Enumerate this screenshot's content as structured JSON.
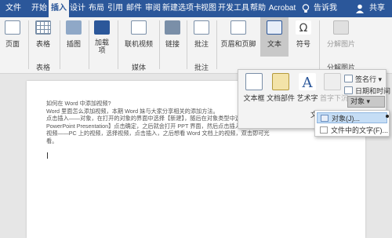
{
  "tabs": {
    "file": "文件",
    "home": "开始",
    "insert": "插入",
    "design": "设计",
    "layout": "布局",
    "references": "引用",
    "mailings": "邮件",
    "review": "审阅",
    "newtab": "新建选项卡",
    "view": "视图",
    "developer": "开发工具",
    "help": "帮助",
    "acrobat": "Acrobat",
    "tell_me": "告诉我",
    "share": "共享"
  },
  "ribbon": {
    "page": "页面",
    "table": "表格",
    "illustrations": "插图",
    "addins": "加载\n项",
    "online_video": "联机视频",
    "links": "链接",
    "comment": "批注",
    "header_footer": "页眉和页脚",
    "text": "文本",
    "symbols": "符号",
    "split_images": "分解图片",
    "groups": {
      "table": "表格",
      "media": "媒体",
      "comments": "批注",
      "split_images": "分解图片"
    }
  },
  "text_panel": {
    "textbox": "文本框",
    "quickparts": "文档部件",
    "wordart": "艺术字",
    "dropcap": "首字下沉",
    "signature_line": "签名行",
    "date_time": "日期和时间",
    "object": "对象",
    "group_label": "文"
  },
  "object_menu": {
    "object_item": "对象(J)...",
    "text_from_file": "文件中的文字(F)..."
  },
  "document": {
    "text": "如何在 Word 中添加视频?\nWord 里面怎么添加视频，本期 Word 妹与大家分享相关的添加方法。\n点击插入——对象，在打开的对象的界面中选择【新建】，随后在对象类型中选择【Microsoft\nPowerPoint Presentation】点击确定，之后就会打开 PPT 界面，然后点击插入——媒体——\n视频——PC 上的视频，选择视频，点击插入，之后想看 Word 文档上的视频，双击即可光\n看。"
  },
  "colors": {
    "accent": "#2b579a",
    "ribbon_bg": "#f3f3f3",
    "highlight": "#c5ddf5"
  }
}
